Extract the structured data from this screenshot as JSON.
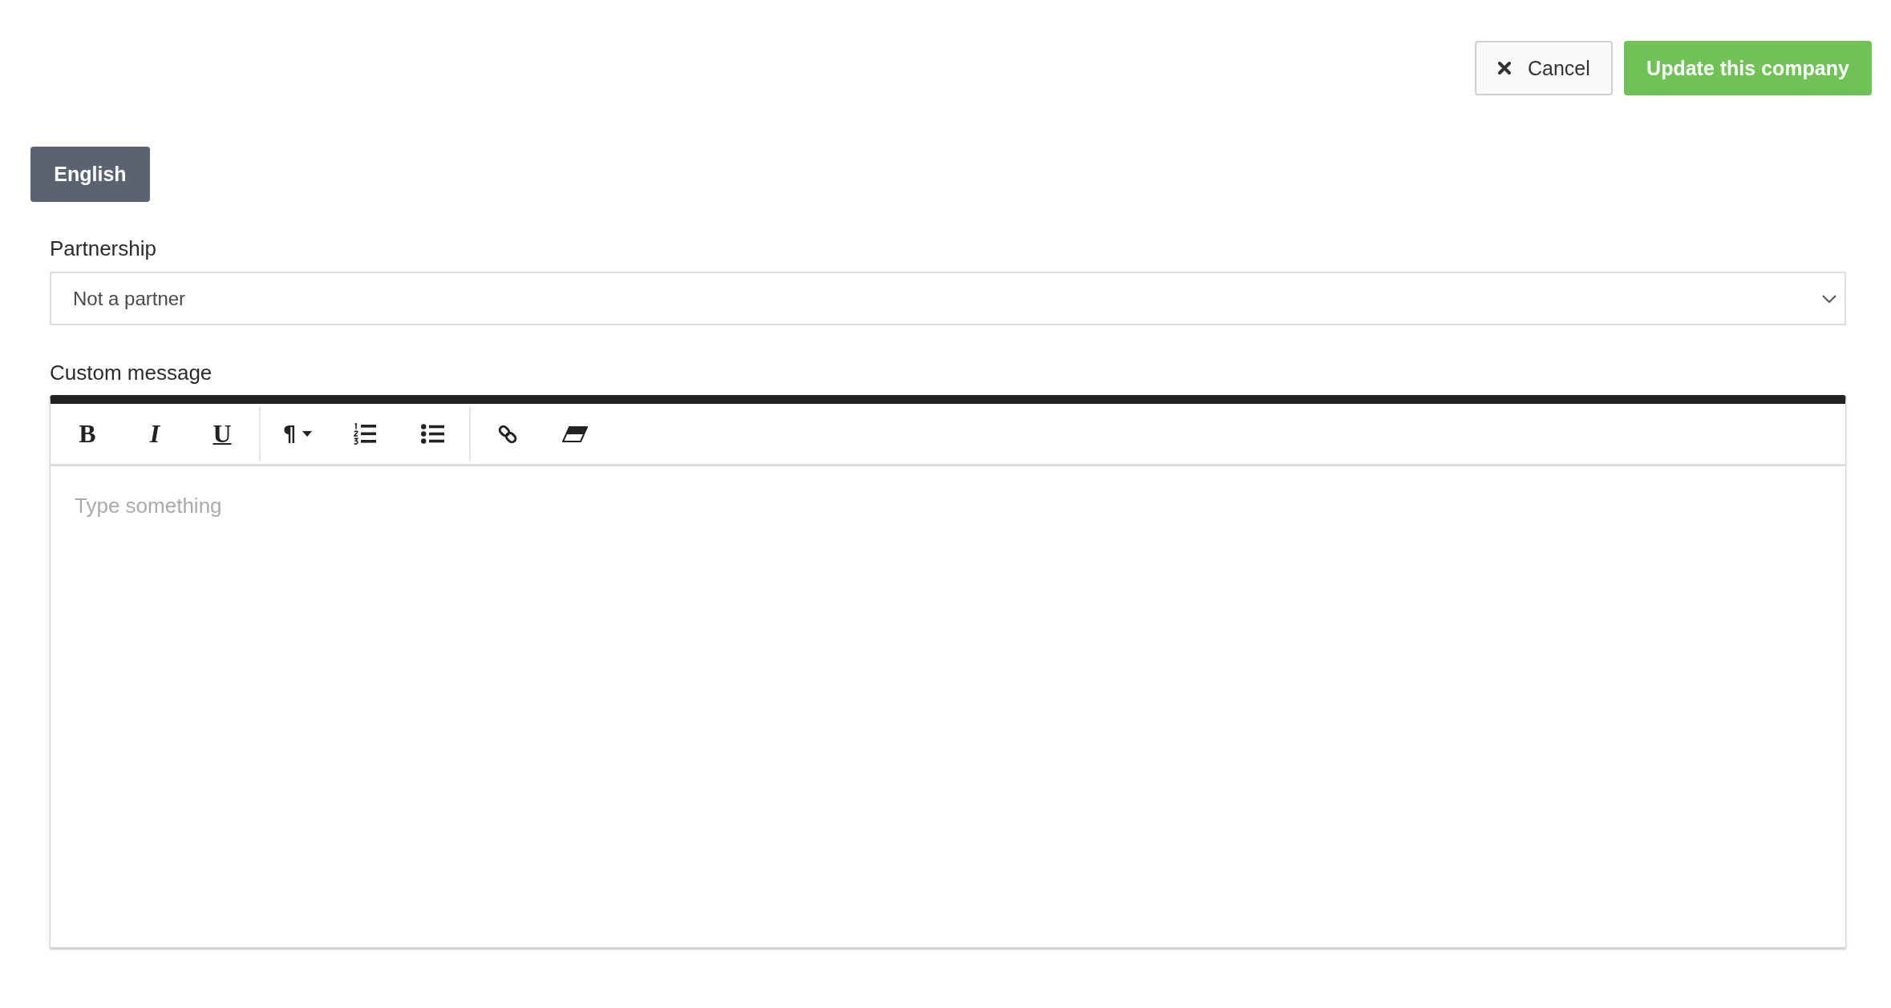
{
  "actions": [
    {
      "label": "Cancel",
      "kind": "secondary"
    },
    {
      "label": "Update this company",
      "kind": "primary"
    }
  ],
  "language_tabs": [
    {
      "label": "English",
      "selected": true
    }
  ],
  "fields": [
    {
      "kind": "select",
      "label": "Partnership",
      "value": "Not a partner"
    },
    {
      "kind": "rich_text",
      "label": "Custom message",
      "placeholder": "Type something",
      "toolbar_groups": [
        {
          "tools": [
            {
              "kind": "bold",
              "label": "B"
            },
            {
              "kind": "italic",
              "label": "I"
            },
            {
              "kind": "underline",
              "label": "U"
            }
          ]
        },
        {
          "tools": [
            {
              "kind": "paragraph",
              "label": "¶"
            },
            {
              "kind": "ordered_list"
            },
            {
              "kind": "bullet_list"
            }
          ]
        },
        {
          "tools": [
            {
              "kind": "link"
            },
            {
              "kind": "eraser"
            }
          ]
        }
      ]
    }
  ]
}
